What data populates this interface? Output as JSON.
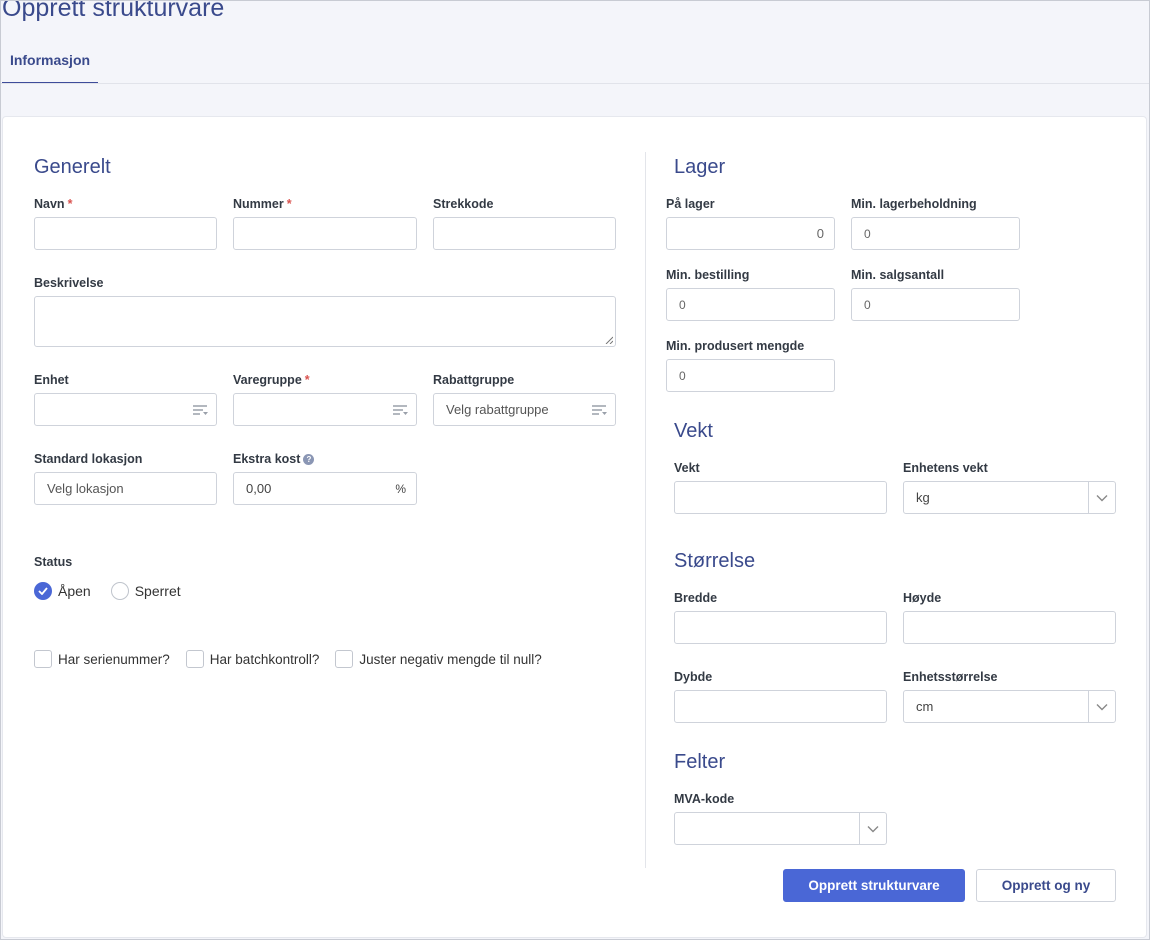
{
  "page": {
    "title": "Opprett strukturvare"
  },
  "tabs": [
    {
      "label": "Informasjon"
    }
  ],
  "general": {
    "heading": "Generelt",
    "name": {
      "label": "Navn",
      "required": "*",
      "value": ""
    },
    "number": {
      "label": "Nummer",
      "required": "*",
      "value": ""
    },
    "barcode": {
      "label": "Strekkode",
      "value": ""
    },
    "description": {
      "label": "Beskrivelse",
      "value": ""
    },
    "unit": {
      "label": "Enhet",
      "value": ""
    },
    "product_group": {
      "label": "Varegruppe",
      "required": "*",
      "value": ""
    },
    "discount_group": {
      "label": "Rabattgruppe",
      "placeholder": "Velg rabattgruppe"
    },
    "standard_location": {
      "label": "Standard lokasjon",
      "placeholder": "Velg lokasjon"
    },
    "extra_cost": {
      "label": "Ekstra kost",
      "info": "?",
      "value": "0,00",
      "suffix": "%"
    },
    "status": {
      "label": "Status",
      "options": [
        {
          "label": "Åpen",
          "checked": true
        },
        {
          "label": "Sperret",
          "checked": false
        }
      ]
    },
    "checkboxes": [
      {
        "label": "Har serienummer?",
        "checked": false
      },
      {
        "label": "Har batchkontroll?",
        "checked": false
      },
      {
        "label": "Juster negativ mengde til null?",
        "checked": false
      }
    ]
  },
  "stock": {
    "heading": "Lager",
    "on_stock": {
      "label": "På lager",
      "placeholder": "0"
    },
    "min_stock": {
      "label": "Min. lagerbeholdning",
      "placeholder": "0"
    },
    "min_order": {
      "label": "Min. bestilling",
      "placeholder": "0"
    },
    "min_sales_qty": {
      "label": "Min. salgsantall",
      "placeholder": "0"
    },
    "min_produced_qty": {
      "label": "Min. produsert mengde",
      "placeholder": "0"
    }
  },
  "weight": {
    "heading": "Vekt",
    "weight": {
      "label": "Vekt",
      "value": ""
    },
    "unit_weight": {
      "label": "Enhetens vekt",
      "value": "kg"
    }
  },
  "size": {
    "heading": "Størrelse",
    "width": {
      "label": "Bredde",
      "value": ""
    },
    "height": {
      "label": "Høyde",
      "value": ""
    },
    "depth": {
      "label": "Dybde",
      "value": ""
    },
    "unit_size": {
      "label": "Enhetsstørrelse",
      "value": "cm"
    }
  },
  "fields": {
    "heading": "Felter",
    "vat_code": {
      "label": "MVA-kode",
      "value": ""
    }
  },
  "actions": {
    "create": "Opprett strukturvare",
    "create_new": "Opprett og ny"
  },
  "colors": {
    "accent": "#4a67d6",
    "heading": "#3a4a8c",
    "required": "#d9534f"
  }
}
